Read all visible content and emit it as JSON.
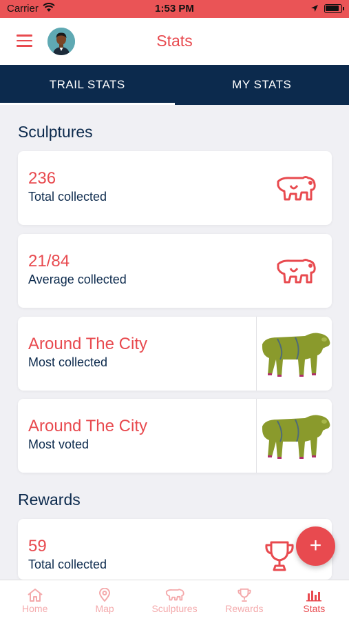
{
  "status_bar": {
    "carrier": "Carrier",
    "time": "1:53 PM"
  },
  "header": {
    "title": "Stats"
  },
  "tabs": [
    {
      "label": "TRAIL STATS",
      "active": true
    },
    {
      "label": "MY STATS",
      "active": false
    }
  ],
  "sculptures": {
    "title": "Sculptures",
    "cards": [
      {
        "value": "236",
        "label": "Total collected",
        "icon": "cow-icon"
      },
      {
        "value": "21/84",
        "label": "Average collected",
        "icon": "cow-icon"
      },
      {
        "value": "Around The City",
        "label": "Most collected",
        "image": "green-cow-sculpture"
      },
      {
        "value": "Around The City",
        "label": "Most voted",
        "image": "green-cow-sculpture"
      }
    ]
  },
  "rewards": {
    "title": "Rewards",
    "cards": [
      {
        "value": "59",
        "label": "Total collected",
        "icon": "trophy-icon"
      }
    ]
  },
  "fab": {
    "label": "+"
  },
  "bottom_nav": [
    {
      "label": "Home",
      "icon": "home-icon"
    },
    {
      "label": "Map",
      "icon": "map-pin-icon"
    },
    {
      "label": "Sculptures",
      "icon": "cow-icon"
    },
    {
      "label": "Rewards",
      "icon": "trophy-icon"
    },
    {
      "label": "Stats",
      "icon": "bar-chart-icon",
      "active": true
    }
  ],
  "colors": {
    "accent": "#e84a4f",
    "navy": "#0c2a4d",
    "status_bar": "#ea5456",
    "inactive_nav": "#f4a9ab"
  }
}
